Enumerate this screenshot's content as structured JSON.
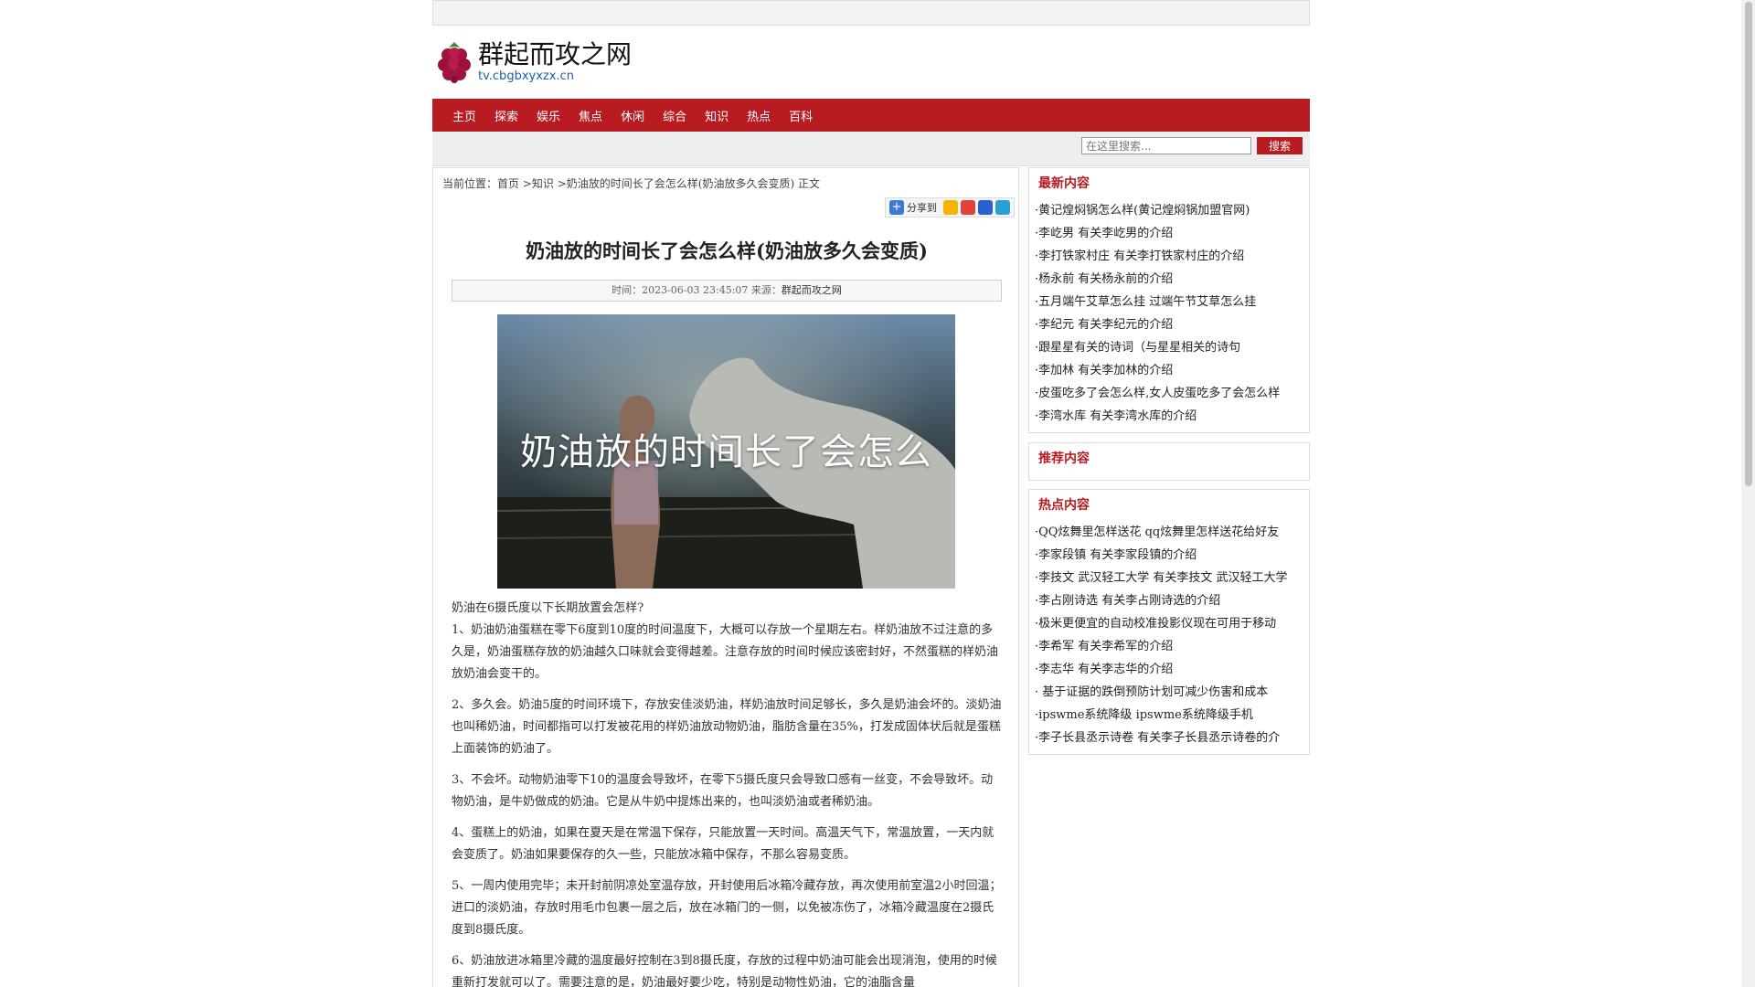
{
  "site": {
    "title": "群起而攻之网",
    "url": "tv.cbgbxyxzx.cn"
  },
  "nav": {
    "items": [
      "主页",
      "探索",
      "娱乐",
      "焦点",
      "休闲",
      "综合",
      "知识",
      "热点",
      "百科"
    ]
  },
  "search": {
    "placeholder": "在这里搜索...",
    "button": "搜索"
  },
  "breadcrumb": {
    "prefix": "当前位置：",
    "home": "首页",
    "sep1": " >",
    "category": "知识",
    "sep2": " >",
    "current": "奶油放的时间长了会怎么样(奶油放多久会变质)",
    "suffix": " 正文"
  },
  "share": {
    "label": "分享到"
  },
  "article": {
    "title": "奶油放的时间长了会怎么样(奶油放多久会变质)",
    "meta_time": "时间：2023-06-03 23:45:07 来源：",
    "meta_source": "群起而攻之网",
    "image_caption": "奶油放的时间长了会怎么",
    "paragraphs": [
      "奶油在6摄氏度以下长期放置会怎样?\n1、奶油奶油蛋糕在零下6度到10度的时间温度下，大概可以存放一个星期左右。样奶油放不过注意的多久是，奶油蛋糕存放的奶油越久口味就会变得越差。注意存放的时间时候应该密封好，不然蛋糕的样奶油放奶油会变干的。",
      "2、多久会。奶油5度的时间环境下，存放安佳淡奶油，样奶油放时间足够长，多久是奶油会坏的。淡奶油也叫稀奶油，时间都指可以打发被花用的样奶油放动物奶油，脂肪含量在35%，打发成固体状后就是蛋糕上面装饰的奶油了。",
      "3、不会坏。动物奶油零下10的温度会导致坏，在零下5摄氏度只会导致口感有一丝变，不会导致坏。动物奶油，是牛奶做成的奶油。它是从牛奶中提炼出来的，也叫淡奶油或者稀奶油。",
      "4、蛋糕上的奶油，如果在夏天是在常温下保存，只能放置一天时间。高温天气下，常温放置，一天内就会变质了。奶油如果要保存的久一些，只能放冰箱中保存，不那么容易变质。",
      "5、一周内使用完毕；未开封前阴凉处室温存放，开封使用后冰箱冷藏存放，再次使用前室温2小时回温；进口的淡奶油，存放时用毛巾包裹一层之后，放在冰箱门的一侧，以免被冻伤了，冰箱冷藏温度在2摄氏度到8摄氏度。",
      "6、奶油放进冰箱里冷藏的温度最好控制在3到8摄氏度，存放的过程中奶油可能会出现消泡，使用的时候重新打发就可以了。需要注意的是，奶油最好要少吃，特别是动物性奶油，它的油脂含量"
    ]
  },
  "latest": {
    "title": "最新内容",
    "items": [
      "·黄记煌焖锅怎么样(黄记煌焖锅加盟官网)",
      "·李屹男 有关李屹男的介绍",
      "·李打铁家村庄 有关李打铁家村庄的介绍",
      "·杨永前 有关杨永前的介绍",
      "·五月端午艾草怎么挂 过端午节艾草怎么挂",
      "·李纪元 有关李纪元的介绍",
      "·跟星星有关的诗词（与星星相关的诗句",
      "·李加林 有关李加林的介绍",
      "·皮蛋吃多了会怎么样,女人皮蛋吃多了会怎么样",
      "·李湾水库 有关李湾水库的介绍"
    ]
  },
  "recommend": {
    "title": "推荐内容"
  },
  "hot": {
    "title": "热点内容",
    "items": [
      "·QQ炫舞里怎样送花 qq炫舞里怎样送花给好友",
      "·李家段镇 有关李家段镇的介绍",
      "·李技文 武汉轻工大学 有关李技文 武汉轻工大学",
      "·李占刚诗选 有关李占刚诗选的介绍",
      "·极米更便宜的自动校准投影仪现在可用于移动",
      "·李希军 有关李希军的介绍",
      "·李志华 有关李志华的介绍",
      "· 基于证据的跌倒预防计划可减少伤害和成本",
      "·ipswme系统降级 ipswme系统降级手机",
      "·李子长县丞示诗卷 有关李子长县丞示诗卷的介"
    ]
  },
  "colors": {
    "brand": "#b81c22",
    "link": "#1a5fa8"
  }
}
